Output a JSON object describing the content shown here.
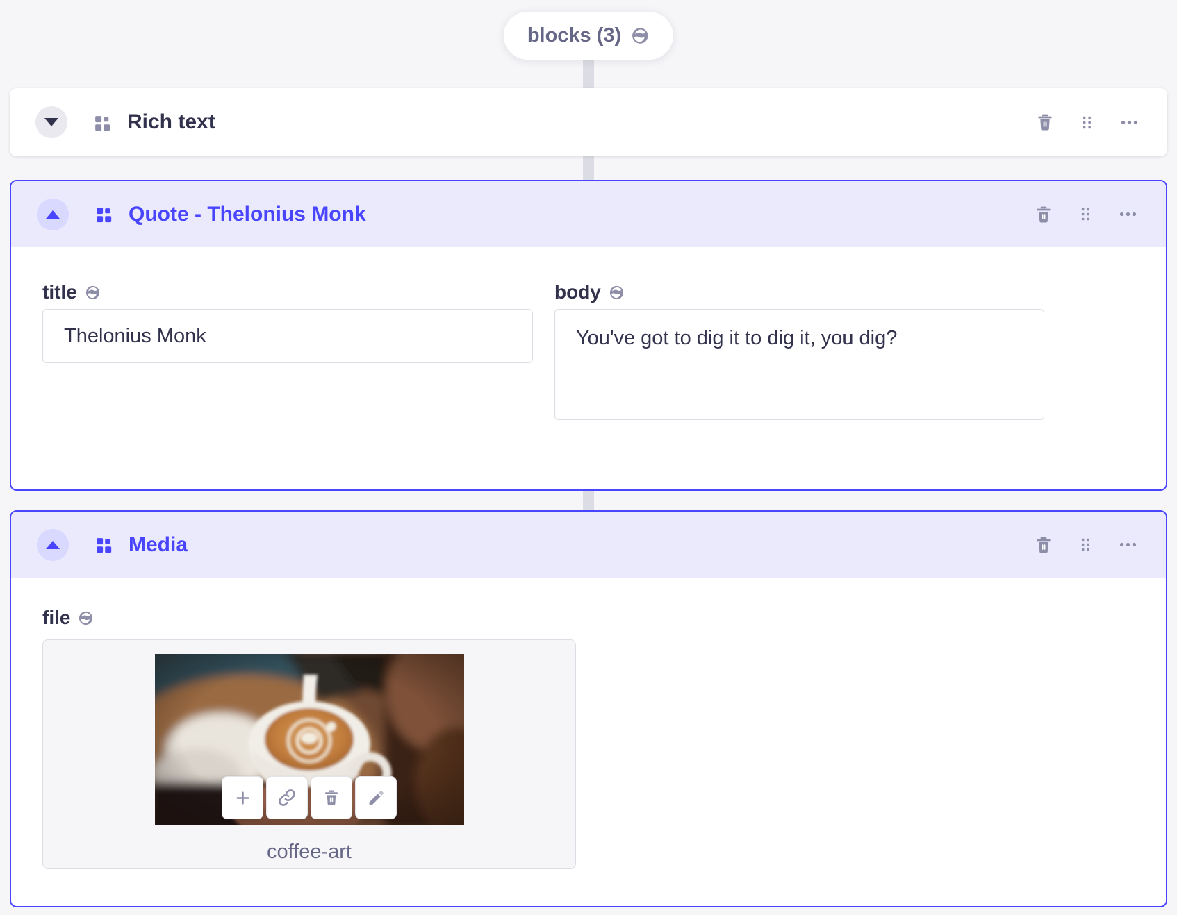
{
  "pill": {
    "label": "blocks (3)",
    "icon": "globe"
  },
  "blocks": [
    {
      "title": "Rich text",
      "state": "collapsed",
      "actions": [
        "delete",
        "drag",
        "more-options"
      ]
    },
    {
      "title": "Quote - Thelonius Monk",
      "state": "expanded",
      "actions": [
        "delete",
        "drag",
        "more-options"
      ],
      "fields": [
        {
          "label": "title",
          "type": "input",
          "value": "Thelonius Monk",
          "localized": true
        },
        {
          "label": "body",
          "type": "textarea",
          "value": "You've got to dig it to dig it, you dig?",
          "localized": true
        }
      ]
    },
    {
      "title": "Media",
      "state": "expanded",
      "actions": [
        "delete",
        "drag",
        "more-options"
      ],
      "fields": [
        {
          "label": "file",
          "type": "media",
          "file_name": "coffee-art",
          "localized": true,
          "media_actions": [
            "add",
            "copy-link",
            "delete",
            "edit"
          ]
        }
      ]
    }
  ],
  "colors": {
    "accent": "#4945ff",
    "accent_header_bg": "#eaeafc",
    "accent_circle_bg": "#d9d8ff",
    "neutral_circle_bg": "#e9e9ef",
    "icon_gray": "#8e8ea9",
    "text_dark": "#32324d",
    "text_muted": "#666687",
    "input_border": "#dcdce4",
    "page_bg": "#f6f6f9",
    "connector": "#dcdce4"
  }
}
